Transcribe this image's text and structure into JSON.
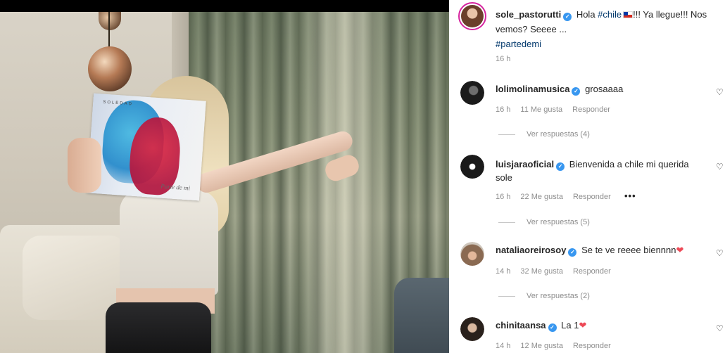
{
  "post": {
    "author": "sole_pastorutti",
    "caption_start": "Hola ",
    "caption_tag": "#chile",
    "caption_flag": "chile-flag",
    "caption_rest": "!!! Ya llegue!!! Nos vemos? Seeee ...",
    "caption_tag2": "#partedemi",
    "time": "16 h",
    "album": {
      "brand": "SOLEDAD",
      "script": "Parte de mi"
    }
  },
  "comments": [
    {
      "user": "lolimolinamusica",
      "text": "grosaaaa",
      "time": "16 h",
      "likes": "11 Me gusta",
      "reply_label": "Responder",
      "view_replies": "Ver respuestas (4)"
    },
    {
      "user": "luisjaraoficial",
      "text": "Bienvenida a chile mi querida sole",
      "time": "16 h",
      "likes": "22 Me gusta",
      "reply_label": "Responder",
      "more": "•••",
      "view_replies": "Ver respuestas (5)"
    },
    {
      "user": "nataliaoreirosoy",
      "text": "Se te ve reeee biennnn",
      "emoji": "❤",
      "time": "14 h",
      "likes": "32 Me gusta",
      "reply_label": "Responder",
      "view_replies": "Ver respuestas (2)"
    },
    {
      "user": "chinitaansa",
      "text": "La 1",
      "emoji": "❤",
      "time": "14 h",
      "likes": "12 Me gusta",
      "reply_label": "Responder"
    }
  ],
  "icons": {
    "like": "heart-outline-icon",
    "verified": "verified-badge-icon"
  },
  "colors": {
    "verified": "#3897f0",
    "hashtag": "#00376b",
    "meta": "#8e8e8e",
    "heart": "#ed4956"
  }
}
